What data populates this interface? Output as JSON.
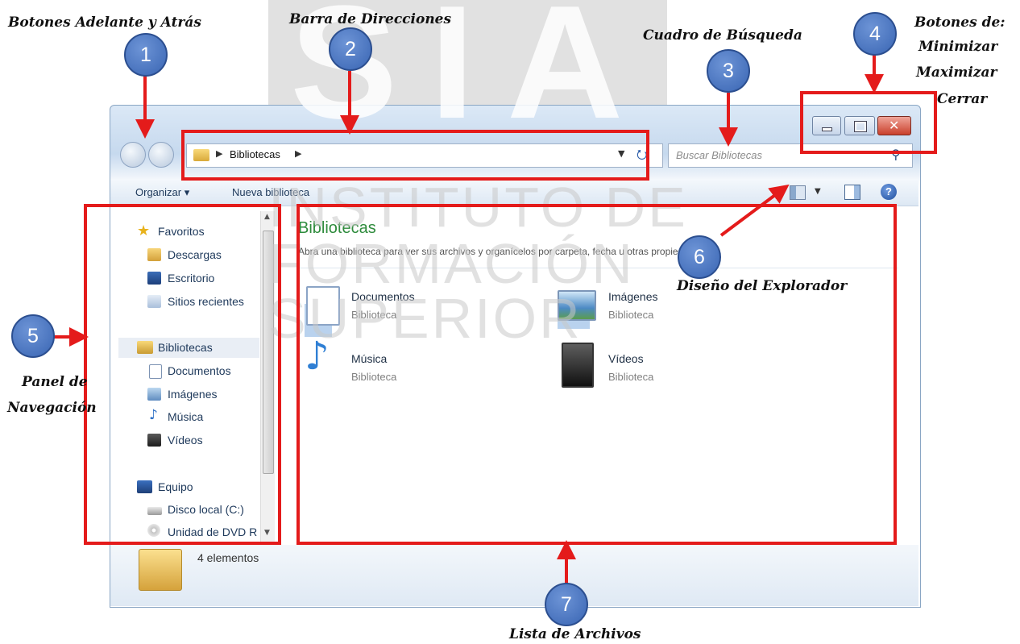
{
  "window": {
    "address_text": "Bibliotecas",
    "search_placeholder": "Buscar Bibliotecas",
    "toolbar": {
      "organize": "Organizar ▾",
      "new_library": "Nueva biblioteca"
    }
  },
  "nav_panel": {
    "favorites_header": "Favoritos",
    "favorites": [
      "Descargas",
      "Escritorio",
      "Sitios recientes"
    ],
    "libraries_header": "Bibliotecas",
    "libraries": [
      "Documentos",
      "Imágenes",
      "Música",
      "Vídeos"
    ],
    "computer_header": "Equipo",
    "drives": [
      "Disco local (C:)",
      "Unidad de DVD R"
    ]
  },
  "content": {
    "title": "Bibliotecas",
    "description": "Abra una biblioteca para ver sus archivos y organícelos por carpeta, fecha u otras propiedades.",
    "libraries": [
      {
        "name": "Documentos",
        "type": "Biblioteca"
      },
      {
        "name": "Imágenes",
        "type": "Biblioteca"
      },
      {
        "name": "Música",
        "type": "Biblioteca"
      },
      {
        "name": "Vídeos",
        "type": "Biblioteca"
      }
    ]
  },
  "status": {
    "item_count": "4 elementos"
  },
  "annotations": {
    "nav_buttons": "Botones Adelante y Atrás",
    "address_bar": "Barra de Direcciones",
    "search_box": "Cuadro de Búsqueda",
    "window_buttons": [
      "Botones de:",
      "Minimizar",
      "Maximizar",
      "Cerrar"
    ],
    "nav_pane": [
      "Panel de",
      "Navegación"
    ],
    "layout": "Diseño del Explorador",
    "file_list": "Lista de Archivos",
    "badges": [
      "1",
      "2",
      "3",
      "4",
      "5",
      "6",
      "7"
    ]
  },
  "watermark": {
    "letters": "SIA",
    "lines": [
      "INSTITUTO DE",
      "FORMACIÓN",
      "SUPERIOR"
    ]
  },
  "colors": {
    "annotation_red": "#e41b1b",
    "badge_blue": "#3965b3",
    "library_title_green": "#2e8b3c"
  }
}
